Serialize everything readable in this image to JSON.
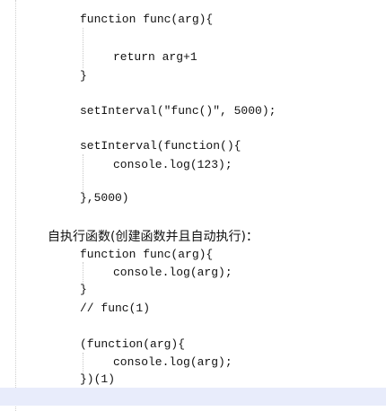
{
  "block1": {
    "func_decl": "function func(arg){",
    "return_line": "return arg+1",
    "close": "}"
  },
  "block2": {
    "set_interval_string": "setInterval(\"func()\", 5000);"
  },
  "block3": {
    "set_interval_fn": "setInterval(function(){",
    "console_log": "console.log(123);",
    "close": "},5000)"
  },
  "heading": "自执行函数(创建函数并且自动执行)：",
  "block4": {
    "func_decl": "function func(arg){",
    "console_log": "console.log(arg);",
    "close": "}",
    "comment": "// func(1)"
  },
  "block5": {
    "iife_open": "(function(arg){",
    "console_log": "console.log(arg);",
    "iife_close": "})(1)"
  }
}
